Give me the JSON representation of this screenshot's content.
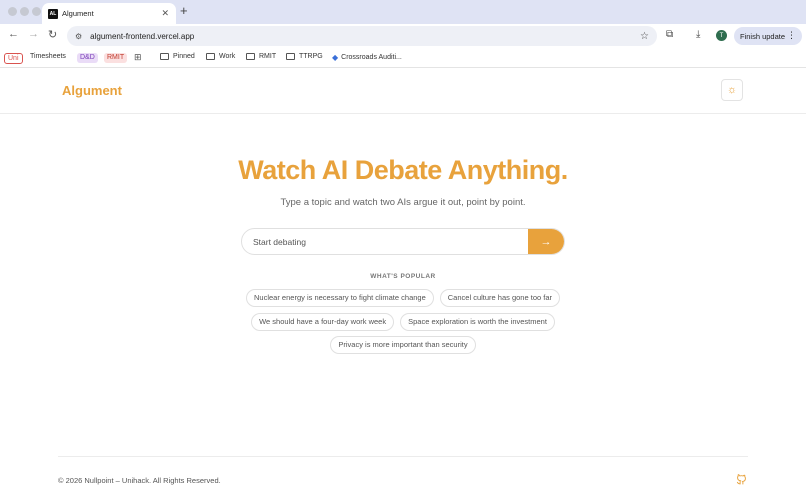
{
  "browser": {
    "tab_title": "Algument",
    "favicon_text": "AL",
    "new_tab_symbol": "+",
    "url": "algument-frontend.vercel.app",
    "profile_initial": "T",
    "finish_update_label": "Finish update",
    "bookmarks": [
      "Uni",
      "Timesheets",
      "D&D",
      "RMIT",
      "Pinned",
      "Work",
      "RMIT",
      "TTRPG",
      "Crossroads Auditi..."
    ]
  },
  "header": {
    "logo": "Algument",
    "theme_icon": "sun-icon"
  },
  "hero": {
    "title": "Watch AI Debate Anything.",
    "subtitle": "Type a topic and watch two AIs argue it out, point by point."
  },
  "search": {
    "placeholder": "Start debating",
    "button_symbol": "→"
  },
  "popular": {
    "label": "WHAT'S POPULAR",
    "topics": [
      "Nuclear energy is necessary to fight climate change",
      "Cancel culture has gone too far",
      "We should have a four-day work week",
      "Space exploration is worth the investment",
      "Privacy is more important than security"
    ]
  },
  "footer": {
    "copyright": "© 2026 Nullpoint – Unihack. All Rights Reserved.",
    "icon": "github-icon"
  },
  "colors": {
    "accent": "#e8a23c",
    "tabbar": "#dfe3f4"
  }
}
